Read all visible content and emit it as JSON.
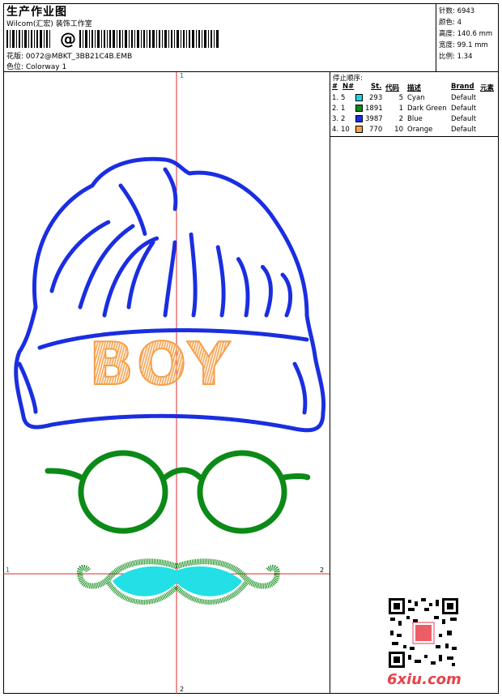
{
  "header": {
    "title": "生产作业图",
    "subtitle": "Wilcom(汇宏) 装饰工作室",
    "design_label": "花版: 0072@MBKT_3BB21C4B.EMB",
    "colorway_label": "色位: Colorway 1"
  },
  "stats": {
    "stitches": "针数: 6943",
    "colors": "颜色: 4",
    "height": "高度: 140.6 mm",
    "width": "宽度: 99.1 mm",
    "scale": "比例: 1.34"
  },
  "stop_sequence": {
    "title": "停止顺序:",
    "headers": [
      "#",
      "N#",
      "St.",
      "代码",
      "描述",
      "Brand",
      "元素"
    ],
    "rows": [
      {
        "seq": "1.",
        "n": "5",
        "st": "293",
        "code": "5",
        "desc": "Cyan",
        "brand": "Default",
        "color": "#22d3e0"
      },
      {
        "seq": "2.",
        "n": "1",
        "st": "1891",
        "code": "1",
        "desc": "Dark Green",
        "brand": "Default",
        "color": "#0c8a17"
      },
      {
        "seq": "3.",
        "n": "2",
        "st": "3987",
        "code": "2",
        "desc": "Blue",
        "brand": "Default",
        "color": "#1a2ee0"
      },
      {
        "seq": "4.",
        "n": "10",
        "st": "770",
        "code": "10",
        "desc": "Orange",
        "brand": "Default",
        "color": "#f5a04a"
      }
    ]
  },
  "design": {
    "hat_text": "BOY",
    "axis_labels": {
      "top": "1",
      "bottom": "2",
      "left": "1",
      "right": "2"
    },
    "colors": {
      "blue": "#1a2ee0",
      "green": "#0c8a17",
      "cyan": "#22e0e6",
      "orange": "#f5a04a",
      "guide": "#e0282e"
    }
  },
  "watermark": "6xiu.com"
}
